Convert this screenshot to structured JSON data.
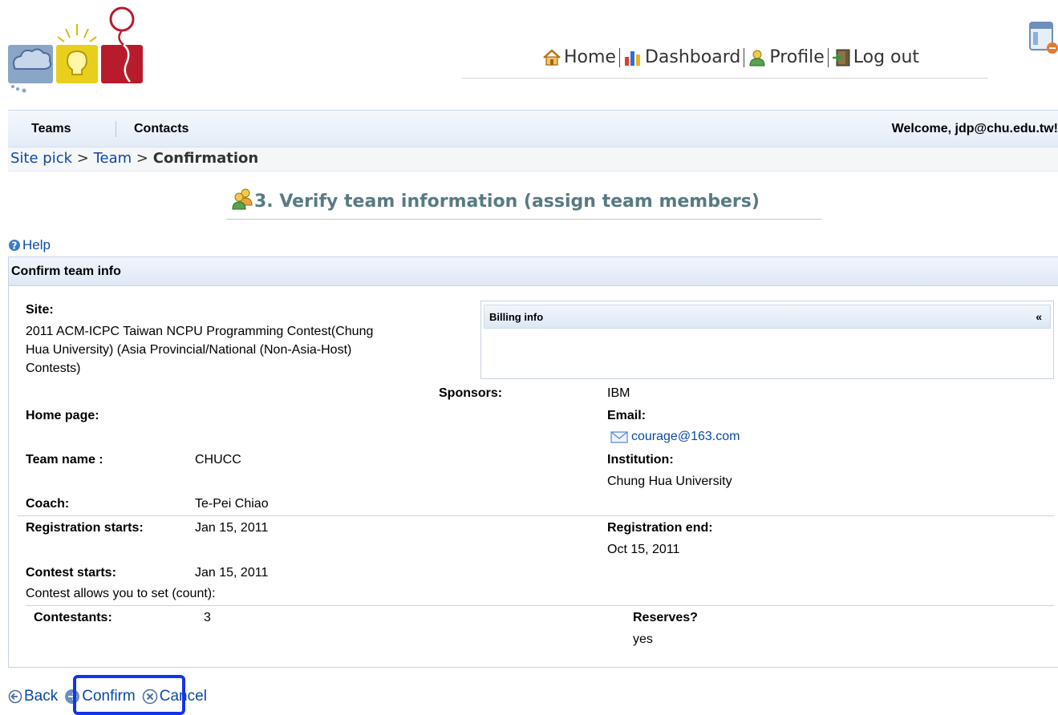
{
  "nav": {
    "home": "Home",
    "dashboard": "Dashboard",
    "profile": "Profile",
    "logout": "Log out"
  },
  "menu": {
    "teams": "Teams",
    "contacts": "Contacts",
    "welcome": "Welcome, jdp@chu.edu.tw!"
  },
  "breadcrumb": {
    "site_pick": "Site pick",
    "separator": ">",
    "team": "Team",
    "current": "Confirmation"
  },
  "title": "3. Verify team information (assign team members)",
  "help": "Help",
  "panel": {
    "header": "Confirm team info",
    "site_label": "Site:",
    "site_value": "2011 ACM-ICPC Taiwan NCPU Programming Contest(Chung Hua University) (Asia Provincial/National (Non-Asia-Host) Contests)",
    "billing_header": "Billing info",
    "billing_toggle": "«",
    "sponsors_label": "Sponsors:",
    "sponsors_value": "IBM",
    "home_page_label": "Home page:",
    "email_label": "Email:",
    "email_value": "courage@163.com",
    "team_name_label": "Team name :",
    "team_name_value": "CHUCC",
    "institution_label": "Institution:",
    "institution_value": "Chung Hua University",
    "coach_label": "Coach:",
    "coach_value": "Te-Pei Chiao",
    "reg_starts_label": "Registration starts:",
    "reg_starts_value": "Jan 15, 2011",
    "reg_end_label": "Registration end:",
    "reg_end_value": "Oct 15, 2011",
    "contest_starts_label": "Contest starts:",
    "contest_starts_value": "Jan 15, 2011",
    "allows_text": "Contest allows you to set (count):",
    "contestants_label": "Contestants:",
    "contestants_value": "3",
    "reserves_label": "Reserves?",
    "reserves_value": "yes"
  },
  "actions": {
    "back": "Back",
    "confirm": "Confirm",
    "cancel": "Cancel"
  },
  "colors": {
    "link": "#0b4aa7",
    "title": "#587a82",
    "highlight": "#1533e8"
  }
}
